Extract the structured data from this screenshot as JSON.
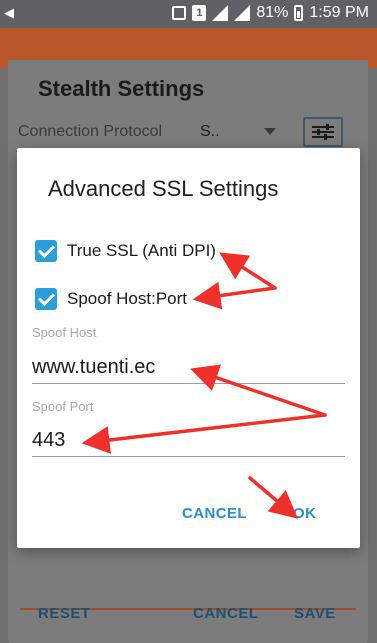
{
  "status_bar": {
    "battery": "81%",
    "time": "1:59 PM",
    "sim_label": "1"
  },
  "stealth_dialog": {
    "title": "Stealth Settings",
    "protocol_label": "Connection Protocol",
    "protocol_value": "S..",
    "buttons": {
      "reset": "RESET",
      "cancel": "CANCEL",
      "save": "SAVE"
    }
  },
  "ssl_dialog": {
    "title": "Advanced SSL Settings",
    "true_ssl": {
      "label": "True SSL (Anti DPI)",
      "checked": true
    },
    "spoof_host_port": {
      "label": "Spoof Host:Port",
      "checked": true
    },
    "spoof_host": {
      "label": "Spoof Host",
      "value": "www.tuenti.ec"
    },
    "spoof_port": {
      "label": "Spoof Port",
      "value": "443"
    },
    "buttons": {
      "cancel": "CANCEL",
      "ok": "OK"
    }
  },
  "colors": {
    "accent": "#2a9ddb",
    "annotation_arrow": "#f0312b",
    "app_bar": "#b8572a"
  }
}
